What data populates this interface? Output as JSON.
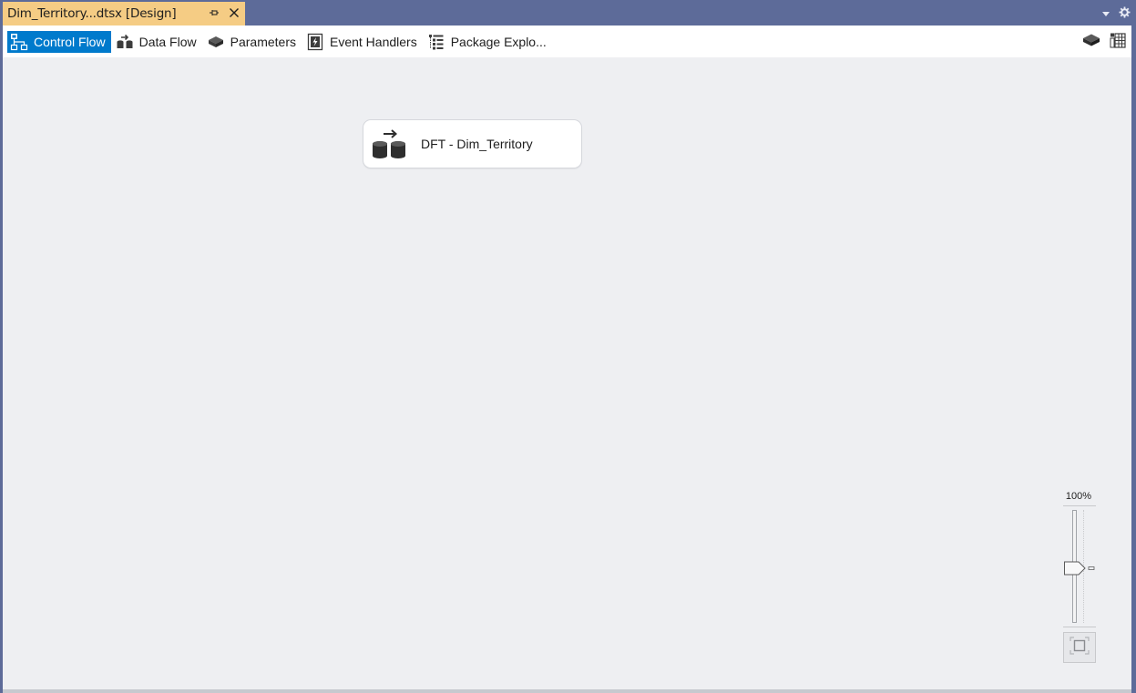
{
  "document_tab": {
    "title": "Dim_Territory...dtsx [Design]",
    "pin_icon": "pin-icon",
    "close_icon": "close-icon"
  },
  "window_controls": {
    "dropdown_icon": "chevron-down-icon",
    "settings_icon": "gear-icon"
  },
  "designer_tabs": [
    {
      "label": "Control Flow",
      "icon": "control-flow-icon",
      "active": true
    },
    {
      "label": "Data Flow",
      "icon": "data-flow-icon",
      "active": false
    },
    {
      "label": "Parameters",
      "icon": "parameters-icon",
      "active": false
    },
    {
      "label": "Event Handlers",
      "icon": "event-handlers-icon",
      "active": false
    },
    {
      "label": "Package Explo...",
      "icon": "package-explorer-icon",
      "active": false
    }
  ],
  "toolbar_right": {
    "variables_icon": "variables-icon",
    "grid_icon": "table-grid-icon"
  },
  "canvas": {
    "task": {
      "label": "DFT - Dim_Territory",
      "icon": "data-flow-task-icon"
    },
    "zoom": {
      "level_label": "100%",
      "fit_icon": "zoom-to-fit-icon"
    }
  },
  "colors": {
    "frame": "#5d6b99",
    "active_document_tab": "#f5cc84",
    "active_designer_tab": "#007acc",
    "canvas": "#eeeff2"
  }
}
